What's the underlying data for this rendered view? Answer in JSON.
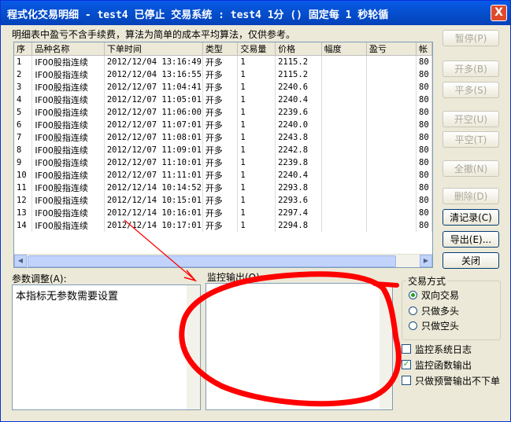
{
  "window": {
    "title": "程式化交易明细 - test4 已停止  交易系统 : test4 1分 () 固定每 1 秒轮循",
    "close_label": "X"
  },
  "notice": "明细表中盈亏不含手续费，算法为简单的成本平均算法，仅供参考。",
  "table": {
    "headers": [
      "序",
      "品种名称",
      "下单时间",
      "类型",
      "交易量",
      "价格",
      "幅度",
      "盈亏",
      "帐"
    ],
    "rows": [
      [
        "1",
        "IF00股指连续",
        "2012/12/04 13:16:49",
        "开多",
        "1",
        "2115.2",
        "",
        "",
        "80"
      ],
      [
        "2",
        "IF00股指连续",
        "2012/12/04 13:16:55",
        "开多",
        "1",
        "2115.2",
        "",
        "",
        "80"
      ],
      [
        "3",
        "IF00股指连续",
        "2012/12/07 11:04:41",
        "开多",
        "1",
        "2240.6",
        "",
        "",
        "80"
      ],
      [
        "4",
        "IF00股指连续",
        "2012/12/07 11:05:01",
        "开多",
        "1",
        "2240.4",
        "",
        "",
        "80"
      ],
      [
        "5",
        "IF00股指连续",
        "2012/12/07 11:06:00",
        "开多",
        "1",
        "2239.6",
        "",
        "",
        "80"
      ],
      [
        "6",
        "IF00股指连续",
        "2012/12/07 11:07:01",
        "开多",
        "1",
        "2240.0",
        "",
        "",
        "80"
      ],
      [
        "7",
        "IF00股指连续",
        "2012/12/07 11:08:01",
        "开多",
        "1",
        "2243.8",
        "",
        "",
        "80"
      ],
      [
        "8",
        "IF00股指连续",
        "2012/12/07 11:09:01",
        "开多",
        "1",
        "2242.8",
        "",
        "",
        "80"
      ],
      [
        "9",
        "IF00股指连续",
        "2012/12/07 11:10:01",
        "开多",
        "1",
        "2239.8",
        "",
        "",
        "80"
      ],
      [
        "10",
        "IF00股指连续",
        "2012/12/07 11:11:01",
        "开多",
        "1",
        "2240.4",
        "",
        "",
        "80"
      ],
      [
        "11",
        "IF00股指连续",
        "2012/12/14 10:14:52",
        "开多",
        "1",
        "2293.8",
        "",
        "",
        "80"
      ],
      [
        "12",
        "IF00股指连续",
        "2012/12/14 10:15:01",
        "开多",
        "1",
        "2293.6",
        "",
        "",
        "80"
      ],
      [
        "13",
        "IF00股指连续",
        "2012/12/14 10:16:01",
        "开多",
        "1",
        "2297.4",
        "",
        "",
        "80"
      ],
      [
        "14",
        "IF00股指连续",
        "2012/12/14 10:17:01",
        "开多",
        "1",
        "2294.8",
        "",
        "",
        "80"
      ]
    ]
  },
  "buttons": {
    "pause": "暂停(P)",
    "open_long": "开多(B)",
    "close_long": "平多(S)",
    "open_short": "开空(U)",
    "close_short": "平空(T)",
    "cancel_all": "全撤(N)",
    "delete": "删除(D)",
    "clear_records": "清记录(C)",
    "export": "导出(E)...",
    "close": "关闭"
  },
  "params": {
    "label": "参数调整(A):",
    "text": "本指标无参数需要设置"
  },
  "monitor": {
    "label": "监控输出(O):"
  },
  "trade_mode": {
    "label": "交易方式",
    "options": [
      "双向交易",
      "只做多头",
      "只做空头"
    ],
    "selected": "双向交易"
  },
  "checkboxes": {
    "system_log": "监控系统日志",
    "function_output": "监控函数输出",
    "alert_only": "只做预警输出不下单"
  },
  "annotation_color": "#ff0000"
}
